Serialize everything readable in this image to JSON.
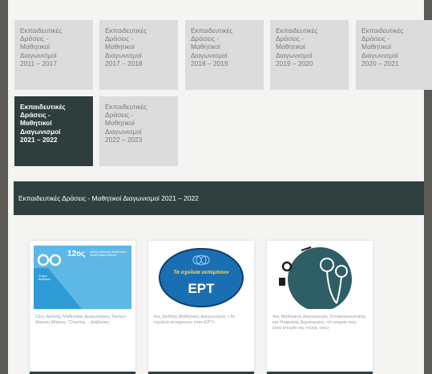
{
  "tabs": [
    {
      "label": "Εκπαιδευτικές\nΔράσεις -\nΜαθητικοί\nΔιαγωνισμοί\n2011 – 2017",
      "active": false
    },
    {
      "label": "Εκπαιδευτικές\nΔράσεις -\nΜαθητικοί\nΔιαγωνισμοί\n2017 – 2018",
      "active": false
    },
    {
      "label": "Εκπαιδευτικές\nΔράσεις -\nΜαθητικοί\nΔιαγωνισμοί\n2018 – 2019",
      "active": false
    },
    {
      "label": "Εκπαιδευτικές\nΔράσεις -\nΜαθητικοί\nΔιαγωνισμοί\n2019 – 2020",
      "active": false
    },
    {
      "label": "Εκπαιδευτικές\nΔράσεις -\nΜαθητικοί\nΔιαγωνισμοί\n2020 – 2021",
      "active": false
    },
    {
      "label": "Εκπαιδευτικές\nΔράσεις -\nΜαθητικοί\nΔιαγωνισμοί\n2021 – 2022",
      "active": true
    },
    {
      "label": "Εκπαιδευτικές\nΔράσεις -\nΜαθητικοί\nΔιαγωνισμοί\n2022 – 2023",
      "active": false
    }
  ],
  "section_title": "Εκπαιδευτικές Δράσεις - Μαθητικοί Διαγωνισμοί 2021 – 2022",
  "cards": [
    {
      "thumb_title": "12ος",
      "thumb_subtitle": "Διεθνής Μαθητικός Διαγωνισμός Ταινιών Μικρού Μήκους",
      "thumb_side": "Σινεμά Διάβασες",
      "text": "12ος Διεθνής Μαθητικός Διαγωνισμός Ταινιών Μικρού Μήκους \"Cinema… Διάβασες;"
    },
    {
      "thumb_caption": "Τα σχολεία εκπέμπουν",
      "thumb_logo": "ΕΡΤ",
      "text": "4ος Διεθνής Μαθητικός Διαγωνισμός «Τα σχολεία εκπέμπουν στην ΕΡΤ»"
    },
    {
      "text": "4ος Μαθητικός Διαγωνισμός Οπτικοακουστικής και Ψηφιακής Δημιουργίας «Η ιστορία σου, είναι ιστορία της πόλης σου»"
    }
  ],
  "colors": {
    "active_tab": "#2e3e3d",
    "inactive_tab": "#dcdcdc",
    "header_bar": "#2f403f",
    "card1_thumb": "#2f9bd6",
    "card2_thumb": "#1a6fb3",
    "card3_thumb": "#2e5e66"
  }
}
